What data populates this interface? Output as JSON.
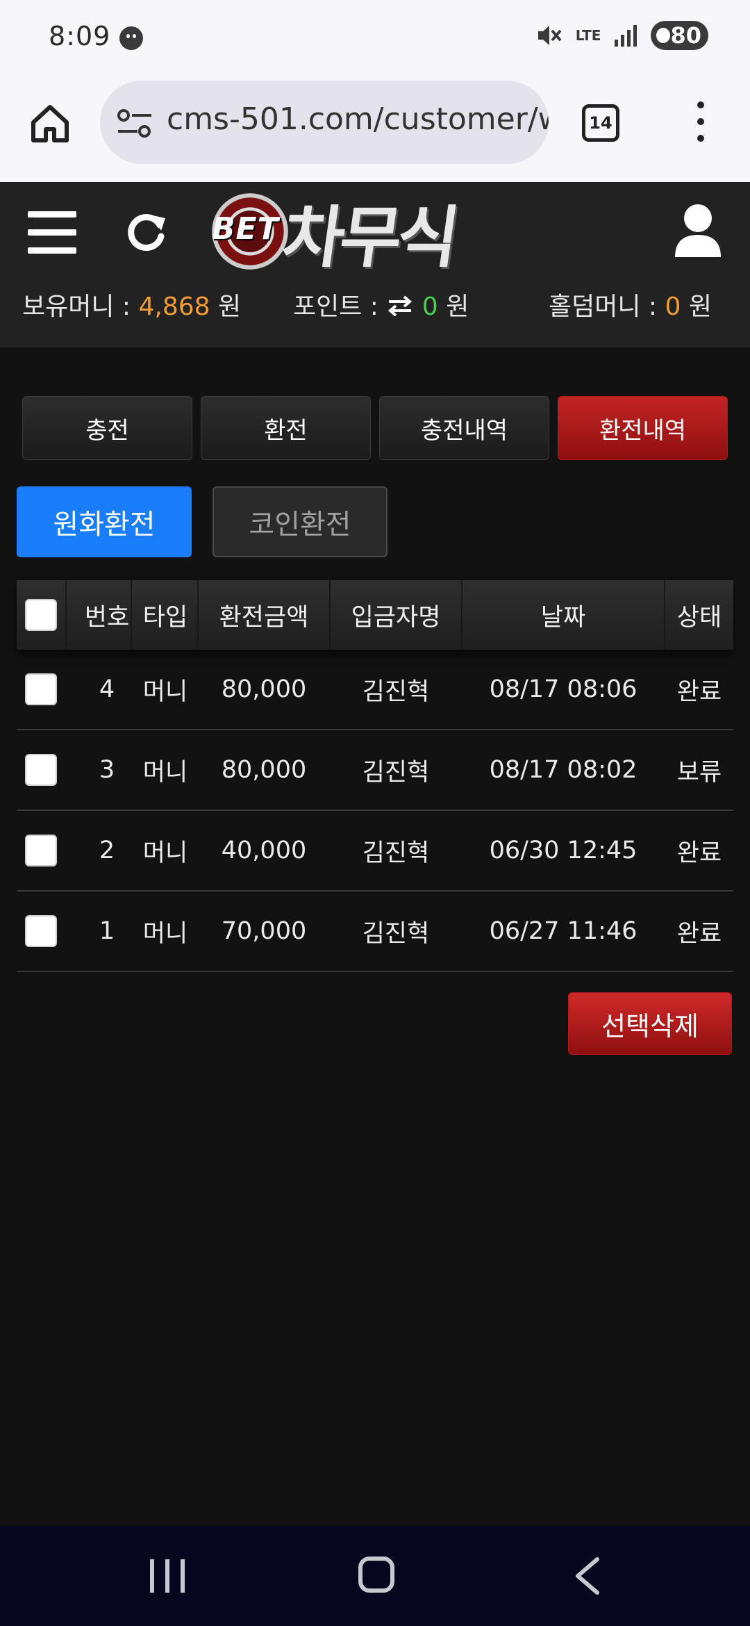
{
  "status_bar": {
    "time": "8:09",
    "network": "LTE",
    "battery": "80"
  },
  "browser": {
    "url": "cms-501.com/customer/w",
    "tab_count": "14"
  },
  "header": {
    "logo_prefix": "BET",
    "logo_name": "차무식"
  },
  "balances": {
    "holding_label": "보유머니 : ",
    "holding_value": "4,868",
    "holding_unit": " 원",
    "point_label": "포인트 : ",
    "point_value": "0",
    "point_unit": " 원",
    "holdem_label": "홀덤머니 : ",
    "holdem_value": "0",
    "holdem_unit": " 원"
  },
  "nav_tabs": [
    {
      "label": "충전",
      "active": false
    },
    {
      "label": "환전",
      "active": false
    },
    {
      "label": "충전내역",
      "active": false
    },
    {
      "label": "환전내역",
      "active": true
    }
  ],
  "sub_tabs": [
    {
      "label": "원화환전",
      "active": true
    },
    {
      "label": "코인환전",
      "active": false
    }
  ],
  "table": {
    "headers": [
      "번호",
      "타입",
      "환전금액",
      "입금자명",
      "날짜",
      "상태"
    ],
    "rows": [
      {
        "no": "4",
        "type": "머니",
        "amount": "80,000",
        "depositor": "김진혁",
        "date": "08/17 08:06",
        "status": "완료"
      },
      {
        "no": "3",
        "type": "머니",
        "amount": "80,000",
        "depositor": "김진혁",
        "date": "08/17 08:02",
        "status": "보류"
      },
      {
        "no": "2",
        "type": "머니",
        "amount": "40,000",
        "depositor": "김진혁",
        "date": "06/30 12:45",
        "status": "완료"
      },
      {
        "no": "1",
        "type": "머니",
        "amount": "70,000",
        "depositor": "김진혁",
        "date": "06/27 11:46",
        "status": "완료"
      }
    ]
  },
  "actions": {
    "delete_selected": "선택삭제"
  },
  "colors": {
    "accent_red": "#c42424",
    "accent_blue": "#1a7efc",
    "money_orange": "#f39c34",
    "point_green": "#4ccf4c"
  }
}
